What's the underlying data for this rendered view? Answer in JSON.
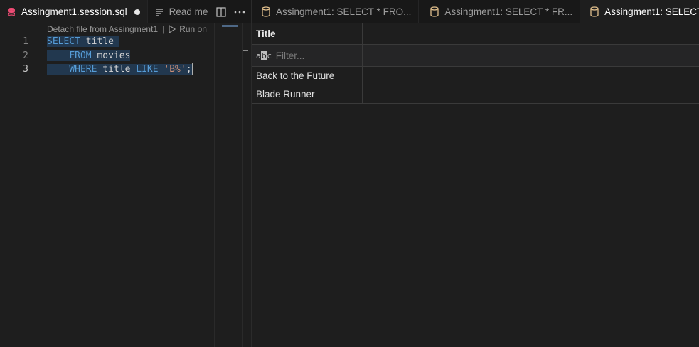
{
  "editor": {
    "tabs": [
      {
        "label": "Assingment1.session.sql",
        "icon": "database-icon",
        "active": true,
        "dirty": true
      },
      {
        "label": "Read me",
        "icon": "preview-icon",
        "active": false
      }
    ],
    "codelens": {
      "detach": "Detach file from Assingment1",
      "separator": "|",
      "run": "Run on"
    },
    "line_numbers": [
      "1",
      "2",
      "3"
    ],
    "code": {
      "l1_kw": "SELECT",
      "l1_id": "title",
      "l2_indent": "    ",
      "l2_kw": "FROM",
      "l2_id": "movies",
      "l3_indent": "    ",
      "l3_kw1": "WHERE",
      "l3_id": "title",
      "l3_kw2": "LIKE",
      "l3_str": "'B%'",
      "l3_end": ";"
    }
  },
  "results": {
    "tabs": [
      {
        "label": "Assingment1: SELECT * FRO...",
        "icon": "database-icon"
      },
      {
        "label": "Assingment1: SELECT *  FR...",
        "icon": "database-icon"
      },
      {
        "label": "Assingment1: SELECT",
        "icon": "database-icon",
        "active": true
      }
    ],
    "column_header": "Title",
    "filter_placeholder": "Filter...",
    "filter_icon_text": "abc",
    "rows": [
      "Back to the Future",
      "Blade Runner"
    ]
  },
  "colors": {
    "accent_db_active": "#f14c75",
    "accent_db": "#e2c08d",
    "keyword": "#569cd6",
    "string": "#ce9178"
  }
}
